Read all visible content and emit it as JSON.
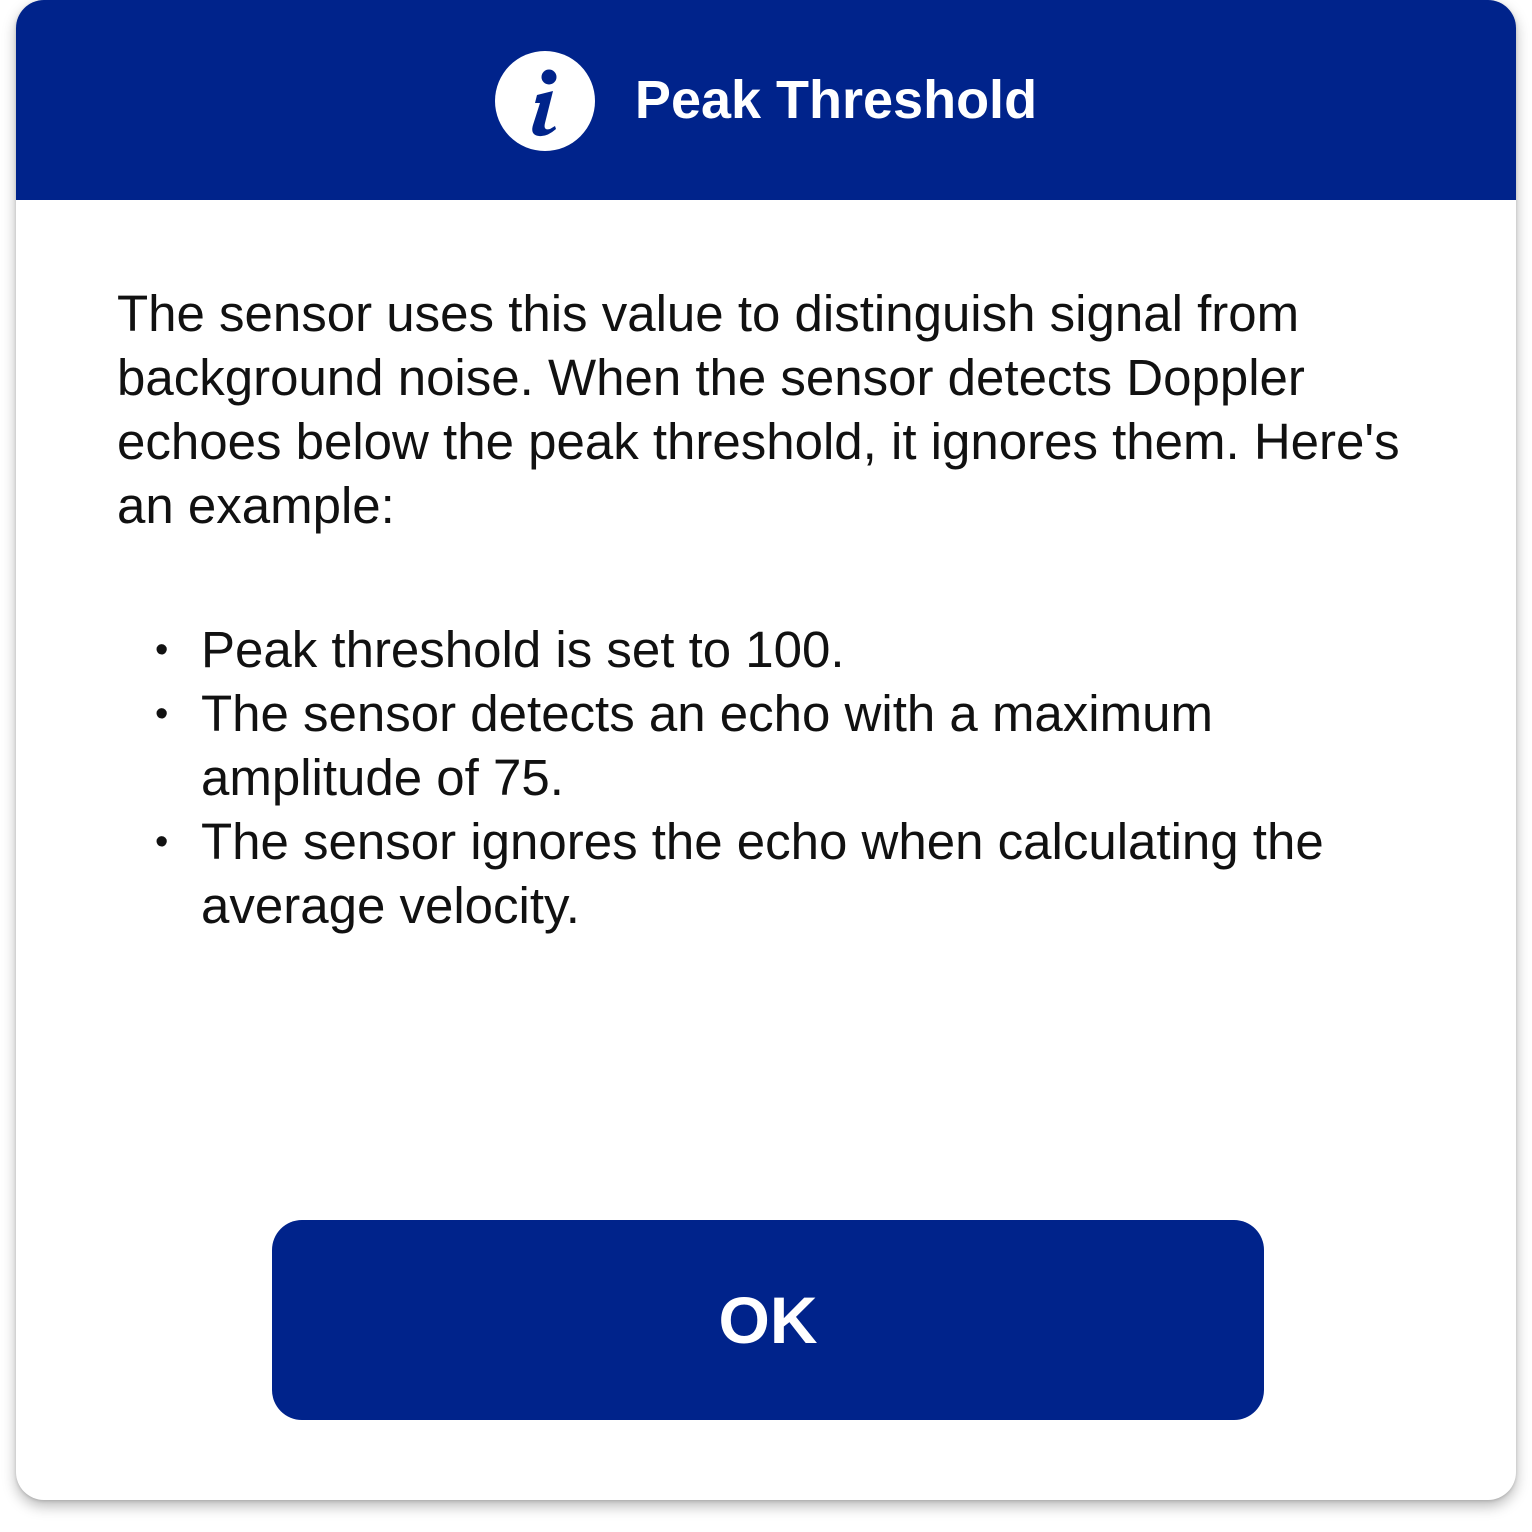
{
  "dialog": {
    "title": "Peak Threshold",
    "icon": "info-icon",
    "description": "The sensor uses this value to distinguish signal from background noise. When the sensor detects Doppler echoes below the peak threshold, it ignores them. Here's an example:",
    "bullets": [
      "Peak threshold is set to 100.",
      "The sensor detects an echo with a maximum amplitude of 75.",
      "The sensor ignores the echo when calculating the average velocity."
    ],
    "ok_label": "OK"
  },
  "colors": {
    "accent": "#00238b",
    "text": "#111111",
    "background": "#ffffff"
  }
}
